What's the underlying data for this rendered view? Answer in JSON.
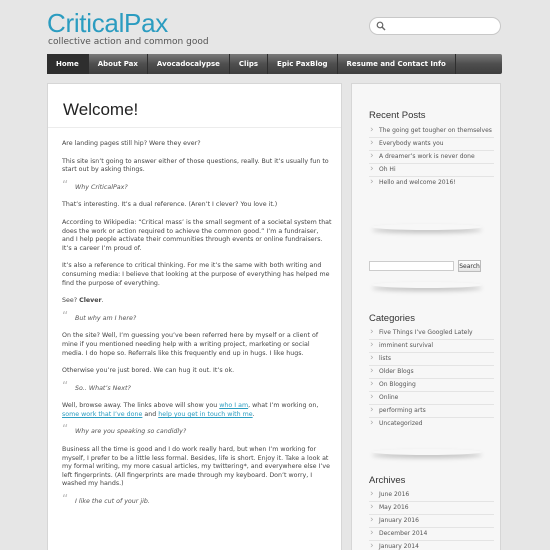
{
  "site": {
    "title": "CriticalPax",
    "description": "collective action and common good"
  },
  "nav": [
    "Home",
    "About Pax",
    "Avocadocalypse",
    "Clips",
    "Epic PaxBlog",
    "Resume and Contact Info"
  ],
  "post": {
    "title": "Welcome!",
    "p1": "Are landing pages still hip? Were they ever?",
    "p2": "This site isn’t going to answer either of those questions, really. But it’s usually fun to start out by asking things.",
    "q1": "Why CriticalPax?",
    "p3": "That’s interesting. It’s a dual reference. (Aren’t I clever? You love it.)",
    "p4": "According to Wikipedia: “Critical mass’ is the small segment of a societal system that does the work or action required to achieve the common good.” I’m a fundraiser, and I help people activate their communities through events or online fundraisers. It’s a career I’m proud of.",
    "p5": "It’s also a reference to critical thinking. For me it’s the same with both writing and consuming media: I believe that looking at the purpose of everything has helped me find the purpose of everything.",
    "p6a": "See? ",
    "p6b": "Clever",
    "p6c": ".",
    "q2": "But why am I here?",
    "p7": "On the site? Well, I’m guessing you’ve been referred here by myself or a client of mine if you mentioned needing help with a writing project, marketing or social media. I do hope so. Referrals like this frequently end up in hugs. I like hugs.",
    "p8": "Otherwise you’re just bored. We can hug it out. It’s ok.",
    "q3": "So.. What’s Next?",
    "p9a": "Well, browse away. The links above will show you ",
    "p9link1": "who I am",
    "p9b": ", what I’m working on, ",
    "p9link2": "some work that I’ve done",
    "p9c": " and ",
    "p9link3": "help you get in touch with me",
    "p9d": ".",
    "q4": "Why are you speaking so candidly?",
    "p10": "Business all the time is good and I do work really hard, but when I’m working for myself, I prefer to be a little less formal. Besides, life is short. Enjoy it. Take a look at my formal writing, my more casual articles, my twittering*, and everywhere else I’ve left fingerprints. (All fingerprints are made through my keyboard. Don’t worry, I washed my hands.)",
    "q5": "I like the cut of your jib."
  },
  "sidebar": {
    "recent_title": "Recent Posts",
    "recent": [
      "The going get tougher on themselves",
      "Everybody wants you",
      "A dreamer’s work is never done",
      "Oh Hi",
      "Hello and welcome 2016!"
    ],
    "search_button": "Search",
    "categories_title": "Categories",
    "categories": [
      "Five Things I’ve Googled Lately",
      "imminent survival",
      "lists",
      "Older Blogs",
      "On Blogging",
      "Online",
      "performing arts",
      "Uncategorized"
    ],
    "archives_title": "Archives",
    "archives": [
      "June 2016",
      "May 2016",
      "January 2016",
      "December 2014",
      "January 2014"
    ]
  }
}
